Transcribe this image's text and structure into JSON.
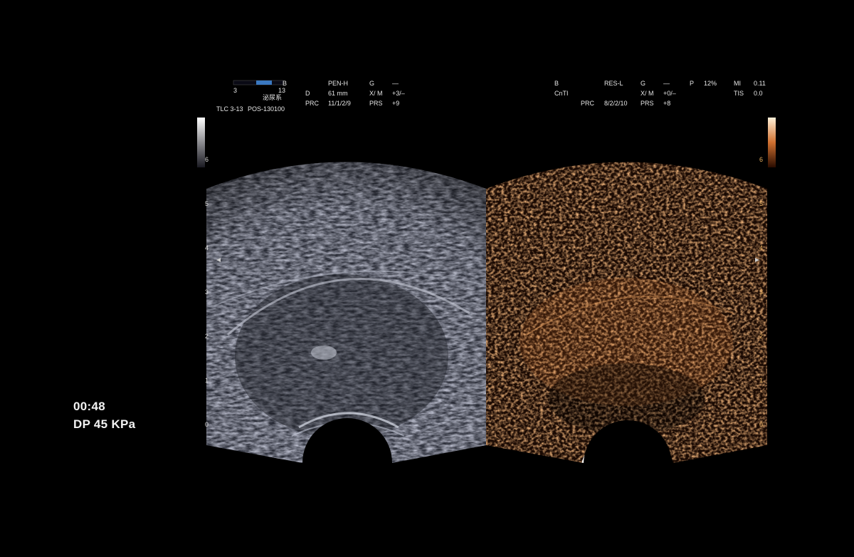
{
  "left_header": {
    "colorbar_right_label": "B",
    "colorbar_min": "3",
    "colorbar_max": "13",
    "organ_label": "泌尿系",
    "probe": "TLC 3-13",
    "position": "POS-130100",
    "params": [
      [
        "",
        "PEN-H",
        "G",
        "—"
      ],
      [
        "D",
        "61 mm",
        "X/ M",
        "+3/–"
      ],
      [
        "PRC",
        "11/1/2/9",
        "PRS",
        "+9"
      ]
    ]
  },
  "right_header": {
    "params": [
      [
        "B",
        "RES-L",
        "G",
        "—",
        "P",
        "12%",
        "MI",
        "0.11"
      ],
      [
        "CnTI",
        "",
        "X/ M",
        "+0/–",
        "",
        "",
        "TIS",
        "0.0"
      ],
      [
        "",
        "PRC",
        "8/2/2/10",
        "PRS",
        "+8",
        "",
        "",
        ""
      ]
    ]
  },
  "depth_scale_left": [
    "6",
    "5",
    "4",
    "3",
    "2",
    "1",
    "0"
  ],
  "depth_scale_right": [
    "6",
    "5",
    "4",
    "3",
    "2",
    "1",
    "0"
  ],
  "timer": "00:48",
  "pressure": "DP  45 KPa",
  "colors": {
    "bmode": "#8a8fa6",
    "contrast": "#b8602a",
    "background": "#000000"
  }
}
